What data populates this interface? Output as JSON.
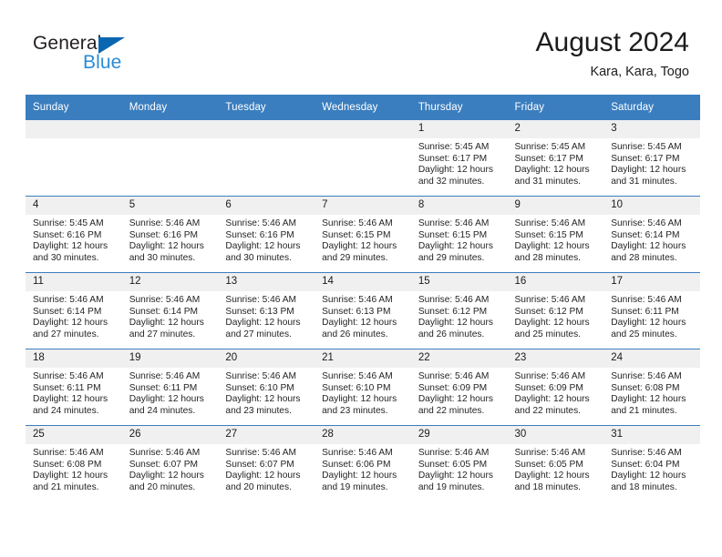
{
  "brand": {
    "name_part1": "General",
    "name_part2": "Blue",
    "triangle_color": "#0b66b2",
    "blue_text_color": "#2a8bd5"
  },
  "header": {
    "title": "August 2024",
    "subtitle": "Kara, Kara, Togo"
  },
  "theme": {
    "header_row_bg": "#3a7ebf",
    "header_row_text": "#ffffff",
    "daynum_band_bg": "#f0f0f0",
    "row_divider": "#3a7ebf",
    "cell_bg": "#ffffff",
    "body_text": "#242424"
  },
  "weekdays": [
    "Sunday",
    "Monday",
    "Tuesday",
    "Wednesday",
    "Thursday",
    "Friday",
    "Saturday"
  ],
  "labels": {
    "sunrise_prefix": "Sunrise:",
    "sunset_prefix": "Sunset:",
    "daylight_prefix": "Daylight:"
  },
  "weeks": [
    [
      {
        "day": "",
        "sunrise": "",
        "sunset": "",
        "daylight_line1": "",
        "daylight_line2": ""
      },
      {
        "day": "",
        "sunrise": "",
        "sunset": "",
        "daylight_line1": "",
        "daylight_line2": ""
      },
      {
        "day": "",
        "sunrise": "",
        "sunset": "",
        "daylight_line1": "",
        "daylight_line2": ""
      },
      {
        "day": "",
        "sunrise": "",
        "sunset": "",
        "daylight_line1": "",
        "daylight_line2": ""
      },
      {
        "day": "1",
        "sunrise": "Sunrise: 5:45 AM",
        "sunset": "Sunset: 6:17 PM",
        "daylight_line1": "Daylight: 12 hours",
        "daylight_line2": "and 32 minutes."
      },
      {
        "day": "2",
        "sunrise": "Sunrise: 5:45 AM",
        "sunset": "Sunset: 6:17 PM",
        "daylight_line1": "Daylight: 12 hours",
        "daylight_line2": "and 31 minutes."
      },
      {
        "day": "3",
        "sunrise": "Sunrise: 5:45 AM",
        "sunset": "Sunset: 6:17 PM",
        "daylight_line1": "Daylight: 12 hours",
        "daylight_line2": "and 31 minutes."
      }
    ],
    [
      {
        "day": "4",
        "sunrise": "Sunrise: 5:45 AM",
        "sunset": "Sunset: 6:16 PM",
        "daylight_line1": "Daylight: 12 hours",
        "daylight_line2": "and 30 minutes."
      },
      {
        "day": "5",
        "sunrise": "Sunrise: 5:46 AM",
        "sunset": "Sunset: 6:16 PM",
        "daylight_line1": "Daylight: 12 hours",
        "daylight_line2": "and 30 minutes."
      },
      {
        "day": "6",
        "sunrise": "Sunrise: 5:46 AM",
        "sunset": "Sunset: 6:16 PM",
        "daylight_line1": "Daylight: 12 hours",
        "daylight_line2": "and 30 minutes."
      },
      {
        "day": "7",
        "sunrise": "Sunrise: 5:46 AM",
        "sunset": "Sunset: 6:15 PM",
        "daylight_line1": "Daylight: 12 hours",
        "daylight_line2": "and 29 minutes."
      },
      {
        "day": "8",
        "sunrise": "Sunrise: 5:46 AM",
        "sunset": "Sunset: 6:15 PM",
        "daylight_line1": "Daylight: 12 hours",
        "daylight_line2": "and 29 minutes."
      },
      {
        "day": "9",
        "sunrise": "Sunrise: 5:46 AM",
        "sunset": "Sunset: 6:15 PM",
        "daylight_line1": "Daylight: 12 hours",
        "daylight_line2": "and 28 minutes."
      },
      {
        "day": "10",
        "sunrise": "Sunrise: 5:46 AM",
        "sunset": "Sunset: 6:14 PM",
        "daylight_line1": "Daylight: 12 hours",
        "daylight_line2": "and 28 minutes."
      }
    ],
    [
      {
        "day": "11",
        "sunrise": "Sunrise: 5:46 AM",
        "sunset": "Sunset: 6:14 PM",
        "daylight_line1": "Daylight: 12 hours",
        "daylight_line2": "and 27 minutes."
      },
      {
        "day": "12",
        "sunrise": "Sunrise: 5:46 AM",
        "sunset": "Sunset: 6:14 PM",
        "daylight_line1": "Daylight: 12 hours",
        "daylight_line2": "and 27 minutes."
      },
      {
        "day": "13",
        "sunrise": "Sunrise: 5:46 AM",
        "sunset": "Sunset: 6:13 PM",
        "daylight_line1": "Daylight: 12 hours",
        "daylight_line2": "and 27 minutes."
      },
      {
        "day": "14",
        "sunrise": "Sunrise: 5:46 AM",
        "sunset": "Sunset: 6:13 PM",
        "daylight_line1": "Daylight: 12 hours",
        "daylight_line2": "and 26 minutes."
      },
      {
        "day": "15",
        "sunrise": "Sunrise: 5:46 AM",
        "sunset": "Sunset: 6:12 PM",
        "daylight_line1": "Daylight: 12 hours",
        "daylight_line2": "and 26 minutes."
      },
      {
        "day": "16",
        "sunrise": "Sunrise: 5:46 AM",
        "sunset": "Sunset: 6:12 PM",
        "daylight_line1": "Daylight: 12 hours",
        "daylight_line2": "and 25 minutes."
      },
      {
        "day": "17",
        "sunrise": "Sunrise: 5:46 AM",
        "sunset": "Sunset: 6:11 PM",
        "daylight_line1": "Daylight: 12 hours",
        "daylight_line2": "and 25 minutes."
      }
    ],
    [
      {
        "day": "18",
        "sunrise": "Sunrise: 5:46 AM",
        "sunset": "Sunset: 6:11 PM",
        "daylight_line1": "Daylight: 12 hours",
        "daylight_line2": "and 24 minutes."
      },
      {
        "day": "19",
        "sunrise": "Sunrise: 5:46 AM",
        "sunset": "Sunset: 6:11 PM",
        "daylight_line1": "Daylight: 12 hours",
        "daylight_line2": "and 24 minutes."
      },
      {
        "day": "20",
        "sunrise": "Sunrise: 5:46 AM",
        "sunset": "Sunset: 6:10 PM",
        "daylight_line1": "Daylight: 12 hours",
        "daylight_line2": "and 23 minutes."
      },
      {
        "day": "21",
        "sunrise": "Sunrise: 5:46 AM",
        "sunset": "Sunset: 6:10 PM",
        "daylight_line1": "Daylight: 12 hours",
        "daylight_line2": "and 23 minutes."
      },
      {
        "day": "22",
        "sunrise": "Sunrise: 5:46 AM",
        "sunset": "Sunset: 6:09 PM",
        "daylight_line1": "Daylight: 12 hours",
        "daylight_line2": "and 22 minutes."
      },
      {
        "day": "23",
        "sunrise": "Sunrise: 5:46 AM",
        "sunset": "Sunset: 6:09 PM",
        "daylight_line1": "Daylight: 12 hours",
        "daylight_line2": "and 22 minutes."
      },
      {
        "day": "24",
        "sunrise": "Sunrise: 5:46 AM",
        "sunset": "Sunset: 6:08 PM",
        "daylight_line1": "Daylight: 12 hours",
        "daylight_line2": "and 21 minutes."
      }
    ],
    [
      {
        "day": "25",
        "sunrise": "Sunrise: 5:46 AM",
        "sunset": "Sunset: 6:08 PM",
        "daylight_line1": "Daylight: 12 hours",
        "daylight_line2": "and 21 minutes."
      },
      {
        "day": "26",
        "sunrise": "Sunrise: 5:46 AM",
        "sunset": "Sunset: 6:07 PM",
        "daylight_line1": "Daylight: 12 hours",
        "daylight_line2": "and 20 minutes."
      },
      {
        "day": "27",
        "sunrise": "Sunrise: 5:46 AM",
        "sunset": "Sunset: 6:07 PM",
        "daylight_line1": "Daylight: 12 hours",
        "daylight_line2": "and 20 minutes."
      },
      {
        "day": "28",
        "sunrise": "Sunrise: 5:46 AM",
        "sunset": "Sunset: 6:06 PM",
        "daylight_line1": "Daylight: 12 hours",
        "daylight_line2": "and 19 minutes."
      },
      {
        "day": "29",
        "sunrise": "Sunrise: 5:46 AM",
        "sunset": "Sunset: 6:05 PM",
        "daylight_line1": "Daylight: 12 hours",
        "daylight_line2": "and 19 minutes."
      },
      {
        "day": "30",
        "sunrise": "Sunrise: 5:46 AM",
        "sunset": "Sunset: 6:05 PM",
        "daylight_line1": "Daylight: 12 hours",
        "daylight_line2": "and 18 minutes."
      },
      {
        "day": "31",
        "sunrise": "Sunrise: 5:46 AM",
        "sunset": "Sunset: 6:04 PM",
        "daylight_line1": "Daylight: 12 hours",
        "daylight_line2": "and 18 minutes."
      }
    ]
  ]
}
